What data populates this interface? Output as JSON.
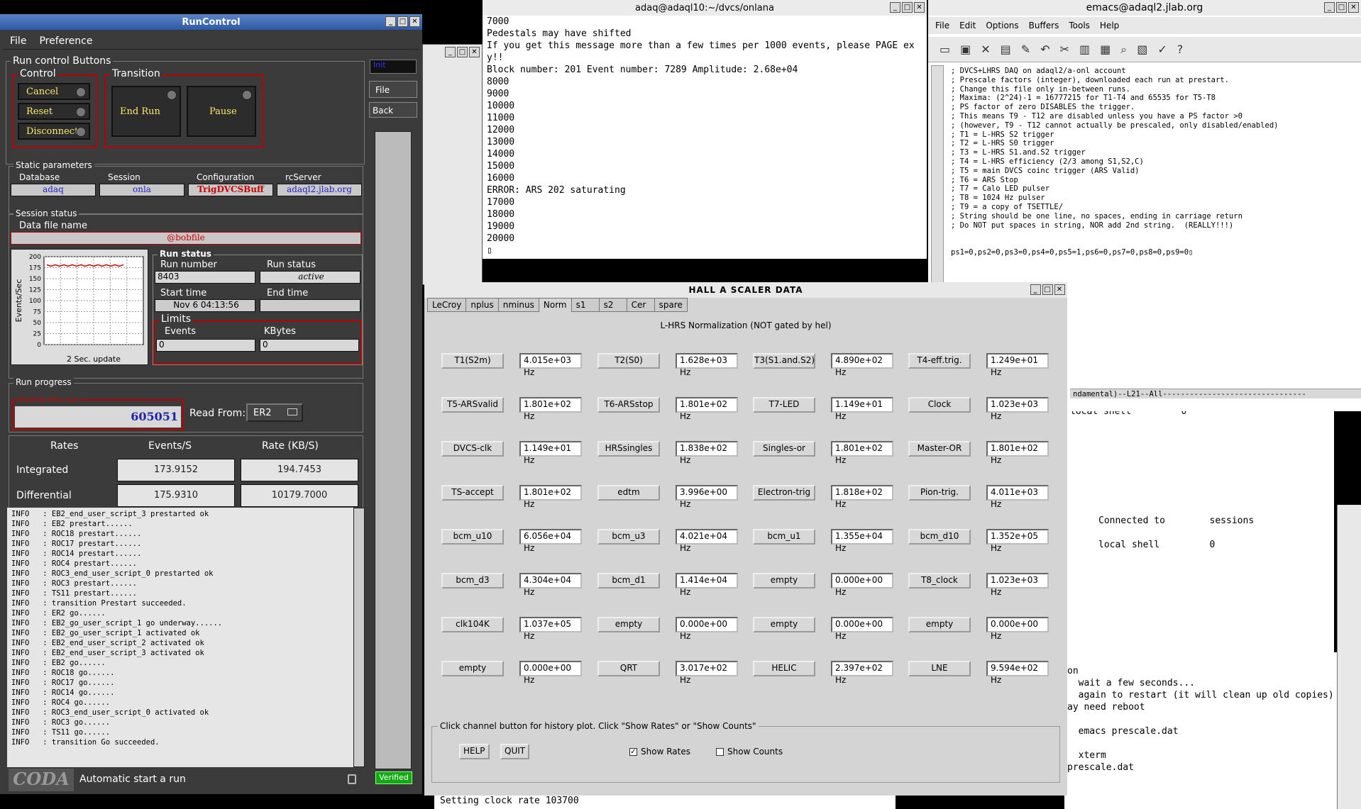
{
  "runcontrol": {
    "title": "RunControl",
    "menu": [
      "File",
      "Preference"
    ],
    "side_buttons": {
      "file": "File",
      "back": "Back",
      "top": "Init"
    },
    "buttons_group_label": "Run control Buttons",
    "control_label": "Control",
    "transition_label": "Transition",
    "control_buttons": [
      "Cancel",
      "Reset",
      "Disconnect"
    ],
    "transition_buttons": [
      "End Run",
      "Pause"
    ],
    "static_params_label": "Static parameters",
    "static_params": [
      {
        "label": "Database",
        "value": "adaq"
      },
      {
        "label": "Session",
        "value": "onla"
      },
      {
        "label": "Configuration",
        "value": "TrigDVCSBuff"
      },
      {
        "label": "rcServer",
        "value": "adaql2.jlab.org"
      }
    ],
    "session_status_label": "Session status",
    "data_file_label": "Data file name",
    "data_file_value": "@bobfile",
    "graph": {
      "ylabel": "Events/Sec",
      "yticks": [
        "200",
        "175",
        "150",
        "125",
        "100",
        "75",
        "50",
        "25",
        "0"
      ],
      "caption": "2 Sec. update",
      "level": 180,
      "ymax": 200
    },
    "run_status_label": "Run status",
    "run_number_label": "Run number",
    "run_number": "8403",
    "run_status_sub_label": "Run status",
    "run_status": "active",
    "start_time_label": "Start time",
    "start_time": "Nov 6 04:13:56",
    "end_time_label": "End time",
    "end_time": "",
    "limits_label": "Limits",
    "events_label": "Events",
    "events_value": "0",
    "kbytes_label": "KBytes",
    "kbytes_value": "0",
    "progress_label": "Run progress",
    "events_this_run_label": "Events this run",
    "events_this_run": "605051",
    "read_from_label": "Read From:",
    "read_from_value": "ER2",
    "rates_header": [
      "Rates",
      "Events/S",
      "Rate (KB/S)"
    ],
    "rates_rows": [
      {
        "name": "Integrated",
        "events": "173.9152",
        "rate": "194.7453"
      },
      {
        "name": "Differential",
        "events": "175.9310",
        "rate": "10179.7000"
      }
    ],
    "log_lines": [
      "INFO   : EB2_end_user_script_3 prestarted ok",
      "INFO   : EB2 prestart......",
      "INFO   : ROC18 prestart......",
      "INFO   : ROC17 prestart......",
      "INFO   : ROC14 prestart......",
      "INFO   : ROC4 prestart......",
      "INFO   : ROC3_end_user_script_0 prestarted ok",
      "INFO   : ROC3 prestart......",
      "INFO   : TS11 prestart......",
      "INFO   : transition Prestart succeeded.",
      "INFO   : ER2 go......",
      "INFO   : EB2_go_user_script_1 go underway......",
      "INFO   : EB2_go_user_script_1 activated ok",
      "INFO   : EB2_end_user_script_2 activated ok",
      "INFO   : EB2_end_user_script_3 activated ok",
      "INFO   : EB2 go......",
      "INFO   : ROC18 go......",
      "INFO   : ROC17 go......",
      "INFO   : ROC14 go......",
      "INFO   : ROC4 go......",
      "INFO   : ROC3_end_user_script_0 activated ok",
      "INFO   : ROC3 go......",
      "INFO   : TS11 go......",
      "INFO   : transition Go succeeded."
    ],
    "footer_logo": "CODA",
    "footer_text": "Automatic start a run",
    "verified": "Verified"
  },
  "terminal": {
    "title": "adaq@adaql10:~/dvcs/onlana",
    "lines": [
      "7000",
      "Pedestals may have shifted",
      "If you get this message more than a few times per 1000 events, please PAGE ex",
      "y!!",
      "Block number: 201 Event number: 7289 Amplitude: 2.68e+04",
      "8000",
      "9000",
      "10000",
      "11000",
      "12000",
      "13000",
      "14000",
      "15000",
      "16000",
      "ERROR: ARS 202 saturating",
      "17000",
      "18000",
      "19000",
      "20000",
      "▯"
    ]
  },
  "emacs": {
    "title": "emacs@adaql2.jlab.org",
    "menu": [
      "File",
      "Edit",
      "Options",
      "Buffers",
      "Tools",
      "Help"
    ],
    "toolbar": [
      "▭",
      "▣",
      "✕",
      "▤",
      "✎",
      "↶",
      "✂",
      "▥",
      "▦",
      "⌕",
      "▧",
      "✓",
      "?"
    ],
    "lines": [
      "; DVCS+LHRS DAQ on adaql2/a-onl account",
      "; Prescale factors (integer), downloaded each run at prestart.",
      "; Change this file only in-between runs.",
      "; Maxima: (2^24)-1 = 16777215 for T1-T4 and 65535 for T5-T8",
      "; PS factor of zero DISABLES the trigger.",
      "; This means T9 - T12 are disabled unless you have a PS factor >0",
      "; (however, T9 - T12 cannot actually be prescaled, only disabled/enabled)",
      "; T1 = L-HRS S2 trigger",
      "; T2 = L-HRS S0 trigger",
      "; T3 = L-HRS S1.and.S2 trigger",
      "; T4 = L-HRS efficiency (2/3 among S1,S2,C)",
      "; T5 = main DVCS coinc trigger (ARS Valid)",
      "; T6 = ARS Stop",
      "; T7 = Calo LED pulser",
      "; T8 = 1024 Hz pulser",
      "; T9 = a copy of TSETTLE/",
      "; String should be one line, no spaces, ending in carriage return",
      "; Do NOT put spaces in string, NOR add 2nd string.  (REALLY!!!)",
      "",
      "",
      "ps1=0,ps2=0,ps3=0,ps4=0,ps5=1,ps6=0,ps7=0,ps8=0,ps9=0▯"
    ],
    "modeline": "ndamental)--L21--All--------------------------------"
  },
  "scaler": {
    "title": "HALL  A  SCALER  DATA",
    "tabs": [
      "LeCroy",
      "nplus",
      "nminus",
      "Norm",
      "s1",
      "s2",
      "Cer",
      "spare"
    ],
    "active_tab": "Norm",
    "heading": "L-HRS Normalization (NOT gated by hel)",
    "rows": [
      [
        [
          "T1(S2m)",
          "4.015e+03 Hz"
        ],
        [
          "T2(S0)",
          "1.628e+03 Hz"
        ],
        [
          "T3(S1.and.S2)",
          "4.890e+02 Hz"
        ],
        [
          "T4-eff.trig.",
          "1.249e+01 Hz"
        ]
      ],
      [
        [
          "T5-ARSvalid",
          "1.801e+02 Hz"
        ],
        [
          "T6-ARSstop",
          "1.801e+02 Hz"
        ],
        [
          "T7-LED",
          "1.149e+01 Hz"
        ],
        [
          "Clock",
          "1.023e+03 Hz"
        ]
      ],
      [
        [
          "DVCS-clk",
          "1.149e+01 Hz"
        ],
        [
          "HRSsingles",
          "1.838e+02 Hz"
        ],
        [
          "Singles-or",
          "1.801e+02 Hz"
        ],
        [
          "Master-OR",
          "1.801e+02 Hz"
        ]
      ],
      [
        [
          "TS-accept",
          "1.801e+02 Hz"
        ],
        [
          "edtm",
          "3.996e+00 Hz"
        ],
        [
          "Electron-trig",
          "1.818e+02 Hz"
        ],
        [
          "Pion-trig.",
          "4.011e+03 Hz"
        ]
      ],
      [
        [
          "bcm_u10",
          "6.056e+04 Hz"
        ],
        [
          "bcm_u3",
          "4.021e+04 Hz"
        ],
        [
          "bcm_u1",
          "1.355e+04 Hz"
        ],
        [
          "bcm_d10",
          "1.352e+05 Hz"
        ]
      ],
      [
        [
          "bcm_d3",
          "4.304e+04 Hz"
        ],
        [
          "bcm_d1",
          "1.414e+04 Hz"
        ],
        [
          "empty",
          "0.000e+00 Hz"
        ],
        [
          "T8_clock",
          "1.023e+03 Hz"
        ]
      ],
      [
        [
          "clk104K",
          "1.037e+05 Hz"
        ],
        [
          "empty",
          "0.000e+00 Hz"
        ],
        [
          "empty",
          "0.000e+00 Hz"
        ],
        [
          "empty",
          "0.000e+00 Hz"
        ]
      ],
      [
        [
          "empty",
          "0.000e+00 Hz"
        ],
        [
          "QRT",
          "3.017e+02 Hz"
        ],
        [
          "HELIC",
          "2.397e+02 Hz"
        ],
        [
          "LNE",
          "9.594e+02 Hz"
        ]
      ]
    ],
    "bottom_label": "Click channel button for history plot.  Click \"Show Rates\" or \"Show Counts\"",
    "help": "HELP",
    "quit": "QUIT",
    "show_rates": "Show Rates",
    "show_counts": "Show Counts"
  },
  "background": {
    "status_line": "Setting clock rate 103700",
    "right_lines": [
      {
        "text": "local shell         0",
        "y": 0
      },
      {
        "text": "Connected to        sessions",
        "y": 1
      },
      {
        "text": "local shell         0",
        "y": 2
      }
    ],
    "bottom_lines": [
      "on",
      "  wait a few seconds...",
      "  again to restart (it will clean up old copies)",
      "ay need reboot",
      "",
      "  emacs prescale.dat",
      "",
      "  xterm",
      "prescale.dat"
    ]
  }
}
